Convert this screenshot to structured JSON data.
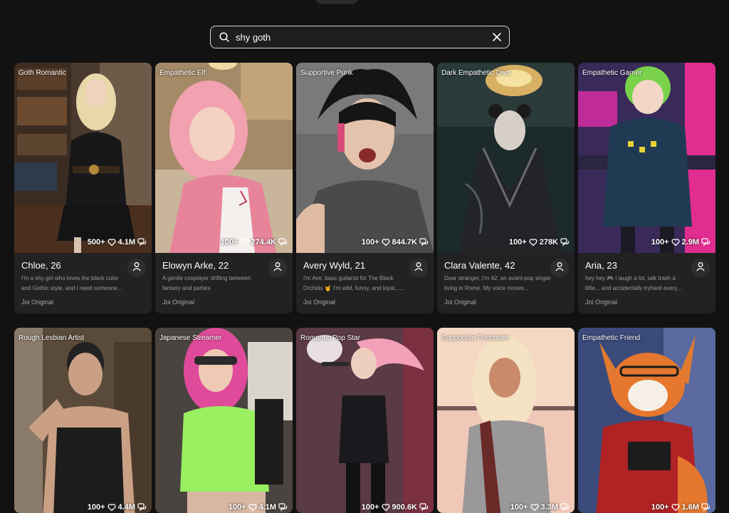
{
  "search": {
    "query": "shy goth",
    "placeholder": "Search"
  },
  "icons": {
    "search": "search-icon",
    "clear": "close-icon",
    "likes": "heart-icon",
    "chats": "chat-bubbles-icon",
    "profile": "user-icon"
  },
  "colors": {
    "background": "#121212",
    "card": "#222222",
    "search_border": "#d9d9d9"
  },
  "cards": [
    {
      "tag": "Goth Romantic",
      "stat_count": "500+",
      "likes": "4.1M",
      "name": "Chloe, 26",
      "desc": "I'm a shy girl who loves the black color and Gothic style, and I need someone...",
      "origin": "Joi Original"
    },
    {
      "tag": "Empathetic Elf",
      "stat_count": "100+",
      "likes": "274.4K",
      "name": "Elowyn Arke, 22",
      "desc": "A gentle cosplayer drifting between fantasy and parties",
      "origin": "Joi Original"
    },
    {
      "tag": "Supportive Punk",
      "stat_count": "100+",
      "likes": "844.7K",
      "name": "Avery Wyld, 21",
      "desc": "I'm Ave, bass guitarist for The Black Orchids 🤘 I'm wild, funny, and loyal......",
      "origin": "Joi Original"
    },
    {
      "tag": "Dark Empathetic Diva",
      "stat_count": "100+",
      "likes": "278K",
      "name": "Clara Valente, 42",
      "desc": "Dear stranger, I'm 42, an avant-pop singer living in Rome. My voice moves...",
      "origin": "Joi Original"
    },
    {
      "tag": "Empathetic Gamer",
      "stat_count": "100+",
      "likes": "2.9M",
      "name": "Aria, 23",
      "desc": "hey hey 🎮 i laugh a lot, talk trash a little... and accidentally tryhard every...",
      "origin": "Joi Original"
    },
    {
      "tag": "Rough Lesbian Artist",
      "stat_count": "100+",
      "likes": "4.4M"
    },
    {
      "tag": "Japanese Streamer",
      "stat_count": "100+",
      "likes": "4.1M"
    },
    {
      "tag": "Romantic Pop Star",
      "stat_count": "100+",
      "likes": "900.6K"
    },
    {
      "tag": "Supportive Podcaster",
      "stat_count": "100+",
      "likes": "3.3M"
    },
    {
      "tag": "Empathetic Friend",
      "stat_count": "100+",
      "likes": "1.6M"
    }
  ]
}
